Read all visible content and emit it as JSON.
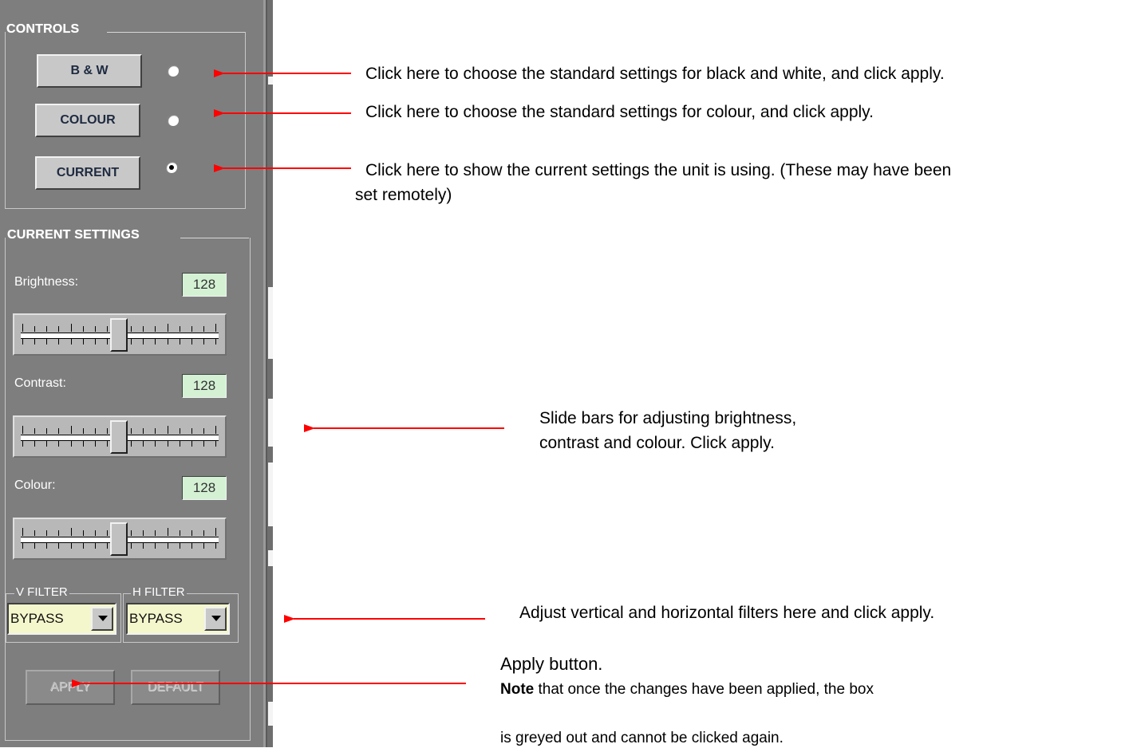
{
  "controls": {
    "title": "CONTROLS",
    "bw_label": "B & W",
    "colour_label": "COLOUR",
    "current_label": "CURRENT",
    "selected": "current"
  },
  "current_settings": {
    "title": "CURRENT SETTINGS",
    "sliders": [
      {
        "key": "brightness",
        "label": "Brightness:",
        "value": "128"
      },
      {
        "key": "contrast",
        "label": "Contrast:",
        "value": "128"
      },
      {
        "key": "colour",
        "label": "Colour:",
        "value": "128"
      }
    ],
    "v_filter": {
      "title": "V FILTER",
      "value": "BYPASS"
    },
    "h_filter": {
      "title": "H FILTER",
      "value": "BYPASS"
    },
    "apply_label": "APPLY",
    "default_label": "DEFAULT"
  },
  "annotations": {
    "bw": "Click here to choose the standard settings for black and white, and click apply.",
    "colour": "Click here to choose the standard settings for colour, and click apply.",
    "current_line1": "Click here to show the current settings the unit is using.  (These may have been",
    "current_line2": "set remotely)",
    "sliders_line1": "Slide bars for adjusting brightness,",
    "sliders_line2": "contrast and colour.  Click apply.",
    "filters": "Adjust vertical and horizontal filters here and click apply.",
    "apply_title": "Apply button.",
    "apply_note_bold": "Note",
    "apply_note_rest": " that once the changes have been applied, the box",
    "apply_note_line2": "is greyed out and cannot be clicked again."
  },
  "colors": {
    "panel": "#7e7e7e",
    "arrow": "#ff0000",
    "value_box": "#d4f1d4",
    "select_bg": "#f4f6cc"
  }
}
